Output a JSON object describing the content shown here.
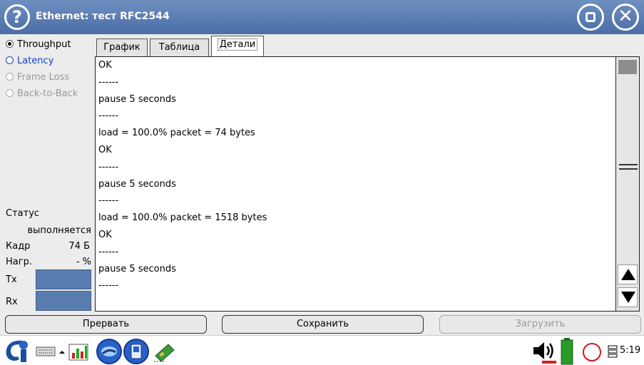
{
  "window": {
    "title": "Ethernet: тест RFC2544"
  },
  "tests": [
    {
      "label": "Throughput",
      "selected": true,
      "state": "normal"
    },
    {
      "label": "Latency",
      "selected": false,
      "state": "active"
    },
    {
      "label": "Frame Loss",
      "selected": false,
      "state": "disabled"
    },
    {
      "label": "Back-to-Back",
      "selected": false,
      "state": "disabled"
    }
  ],
  "status": {
    "status_label": "Статус",
    "status_value": "выполняется",
    "frame_label": "Кадр",
    "frame_value": "74 Б",
    "load_label": "Нагр.",
    "load_value": "- %",
    "tx_label": "Tx",
    "rx_label": "Rx"
  },
  "tabs": [
    {
      "label": "График",
      "active": false
    },
    {
      "label": "Таблица",
      "active": false
    },
    {
      "label": "Детали",
      "active": true
    }
  ],
  "details_lines": [
    "OK",
    "------",
    "pause 5 seconds",
    "------",
    "load = 100.0% packet = 74 bytes",
    "OK",
    "------",
    "pause 5 seconds",
    "------",
    "load = 100.0% packet = 1518 bytes",
    "OK",
    "------",
    "pause 5 seconds",
    "------"
  ],
  "buttons": {
    "abort": "Прервать",
    "save": "Сохранить",
    "load": "Загрузить"
  },
  "taskbar": {
    "clock": "5:19",
    "icons": [
      "start-icon",
      "keyboard-icon",
      "network-icon",
      "globe-icon",
      "pda-icon",
      "card-icon",
      "speaker-icon",
      "battery-icon",
      "record-icon"
    ]
  },
  "colors": {
    "titlebar": "#4a6ea6",
    "accent_blue": "#1a3fc9",
    "tx_rx_bar": "#5a7db0"
  }
}
